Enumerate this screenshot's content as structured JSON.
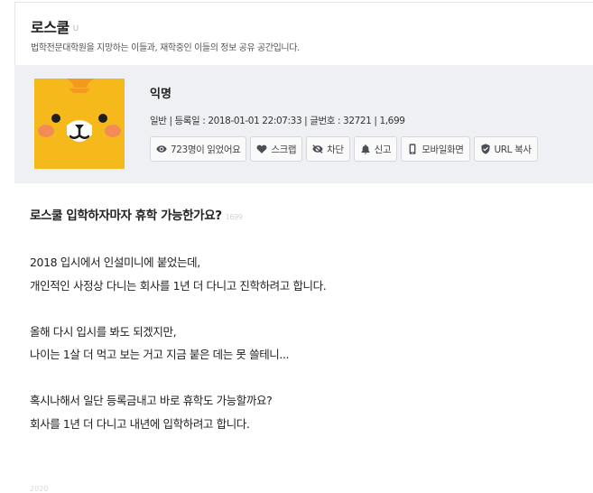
{
  "board": {
    "title": "로스쿨",
    "badge": "U",
    "description": "법학전문대학원을 지망하는 이들과, 재학중인 이들의 정보 공유 공간입니다."
  },
  "post_info": {
    "author": "익명",
    "meta": "일반 | 등록일 : 2018-01-01 22:07:33 | 글번호 : 32721 | 1,699",
    "actions": [
      {
        "label": "723명이 읽었어요",
        "icon": "eye-icon"
      },
      {
        "label": "스크랩",
        "icon": "heart-icon"
      },
      {
        "label": "차단",
        "icon": "eye-slash-icon"
      },
      {
        "label": "신고",
        "icon": "bell-icon"
      },
      {
        "label": "모바일화면",
        "icon": "mobile-icon"
      },
      {
        "label": "URL 복사",
        "icon": "shield-check-icon"
      }
    ]
  },
  "post": {
    "title": "로스쿨 입학하자마자 휴학 가능한가요?",
    "title_number": "1699",
    "lines": [
      "2018 입시에서 인설미니에 붙었는데,",
      "개인적인 사정상 다니는 회사를 1년 더 다니고 진학하려고 합니다.",
      "",
      "올해 다시 입시를 봐도 되겠지만,",
      "나이는 1살 더 먹고 보는 거고 지금 붙은 데는 못 쓸테니...",
      "",
      "혹시나해서 일단 등록금내고 바로 휴학도 가능할까요?",
      "회사를 1년 더 다니고 내년에 입학하려고 합니다."
    ],
    "footer_mark": "2020"
  }
}
